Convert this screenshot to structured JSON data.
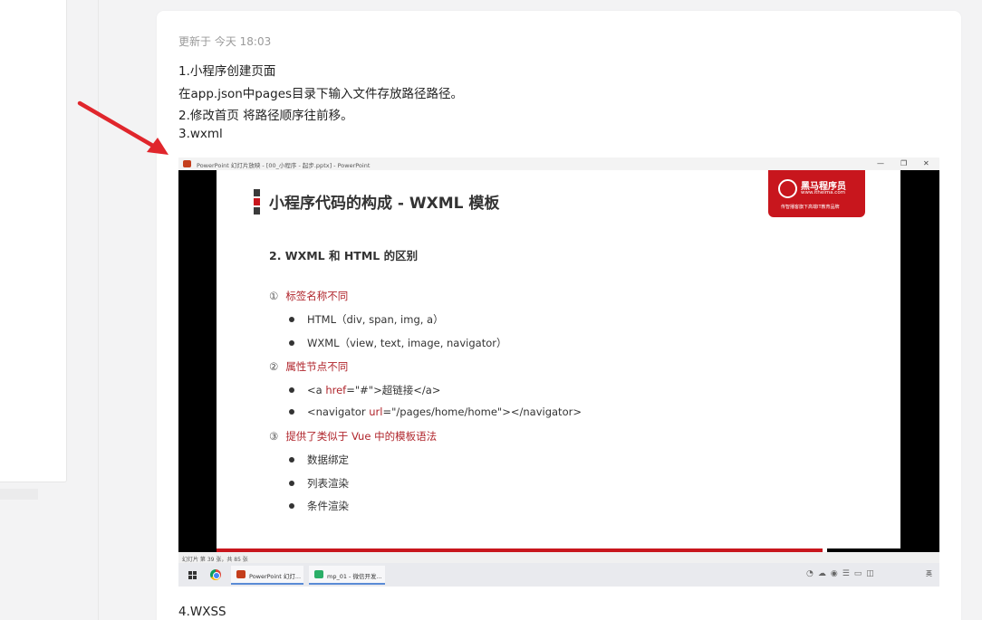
{
  "note": {
    "updated": "更新于 今天 18:03",
    "lines": [
      "1.小程序创建页面",
      "在app.json中pages目录下输入文件存放路径路径。",
      "2.修改首页 将路径顺序往前移。",
      "3.wxml"
    ],
    "after": "4.WXSS"
  },
  "screenshot": {
    "window_title": "PowerPoint 幻灯片放映 - [00_小程序 - 起步.pptx] - PowerPoint",
    "window_controls": [
      "—",
      "❐",
      "✕"
    ],
    "slide": {
      "title": "小程序代码的构成 - WXML 模板",
      "brand": {
        "name": "黑马程序员",
        "url": "www.itheima.com",
        "slogan": "传智播客旗下高端IT教育品牌"
      },
      "subheading": "2. WXML 和 HTML 的区别",
      "sections": [
        {
          "num": "①",
          "title": "标签名称不同",
          "items": [
            {
              "pre": "HTML（div, span, img, a）",
              "red": "",
              "post": ""
            },
            {
              "pre": "WXML（view, text, image, navigator）",
              "red": "",
              "post": ""
            }
          ]
        },
        {
          "num": "②",
          "title": "属性节点不同",
          "items": [
            {
              "pre": "<a ",
              "red": "href",
              "post": "=\"#\">超链接</a>"
            },
            {
              "pre": "<navigator ",
              "red": "url",
              "post": "=\"/pages/home/home\"></navigator>"
            }
          ]
        },
        {
          "num": "③",
          "title": "提供了类似于 Vue 中的模板语法",
          "items": [
            {
              "pre": "数据绑定",
              "red": "",
              "post": ""
            },
            {
              "pre": "列表渲染",
              "red": "",
              "post": ""
            },
            {
              "pre": "条件渲染",
              "red": "",
              "post": ""
            }
          ]
        }
      ]
    },
    "statusbar": "幻灯片 第 39 张，共 85 张",
    "taskbar": {
      "apps": [
        {
          "label": "PowerPoint 幻灯...",
          "color": "#c43e1c"
        },
        {
          "label": "mp_01 - 微信开发...",
          "color": "#2aae67"
        }
      ],
      "tray_right": "英"
    }
  },
  "colors": {
    "accent_red": "#c8161d",
    "text": "#222222",
    "muted": "#9a9a9a",
    "arrow": "#e0262c"
  }
}
